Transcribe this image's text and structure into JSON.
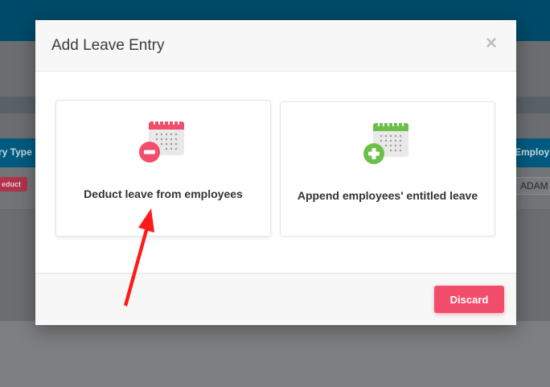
{
  "background": {
    "table_headers": [
      "ry Type",
      "Employ"
    ],
    "badge": "educt",
    "cell_value": "ADAM"
  },
  "modal": {
    "title": "Add Leave Entry",
    "close_glyph": "×",
    "options": [
      {
        "label": "Deduct leave from employees",
        "icon": "calendar-minus-icon",
        "accent": "#f24d6b"
      },
      {
        "label": "Append employees' entitled leave",
        "icon": "calendar-plus-icon",
        "accent": "#6cc04a"
      }
    ],
    "footer": {
      "discard_label": "Discard"
    }
  },
  "colors": {
    "topbar": "#004a69",
    "deduct_accent": "#f24d6b",
    "append_accent": "#6cc04a",
    "annotation_arrow": "#ff1a1a"
  }
}
